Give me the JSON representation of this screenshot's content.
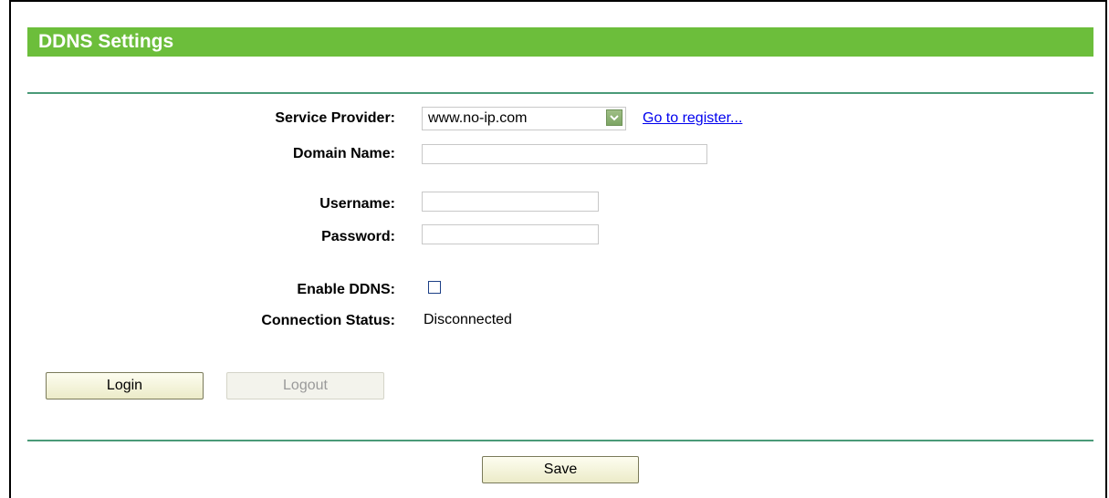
{
  "header": {
    "title": "DDNS Settings"
  },
  "form": {
    "service_provider": {
      "label": "Service Provider:",
      "selected": "www.no-ip.com",
      "link_text": "Go to register..."
    },
    "domain_name": {
      "label": "Domain Name:",
      "value": ""
    },
    "username": {
      "label": "Username:",
      "value": ""
    },
    "password": {
      "label": "Password:",
      "value": ""
    },
    "enable_ddns": {
      "label": "Enable DDNS:",
      "checked": false
    },
    "connection_status": {
      "label": "Connection Status:",
      "value": "Disconnected"
    }
  },
  "buttons": {
    "login": "Login",
    "logout": "Logout",
    "save": "Save"
  },
  "colors": {
    "title_bar": "#6cbe3b",
    "divider": "#4a9a78",
    "link": "#0000ee"
  }
}
